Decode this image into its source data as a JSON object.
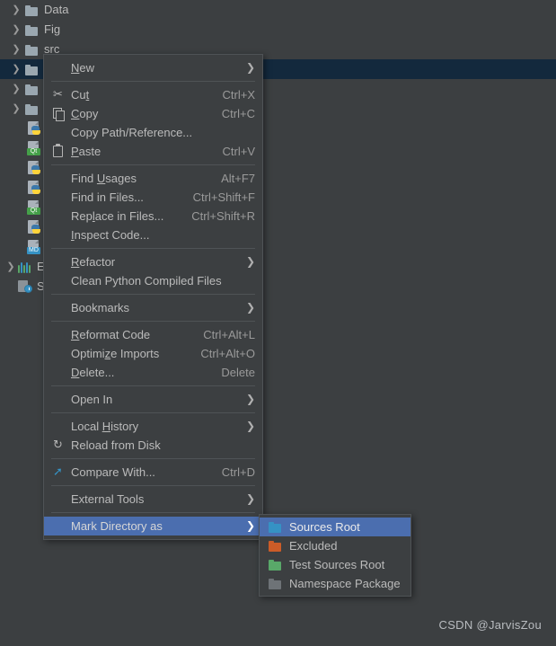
{
  "tree": {
    "folders": [
      {
        "label": "Data",
        "selected": false,
        "expandable": true
      },
      {
        "label": "Fig",
        "selected": false,
        "expandable": true
      },
      {
        "label": "src",
        "selected": false,
        "expandable": true
      },
      {
        "label": "",
        "selected": true,
        "expandable": true
      },
      {
        "label": "",
        "selected": false,
        "expandable": true
      },
      {
        "label": "",
        "selected": false,
        "expandable": true
      }
    ],
    "files": [
      {
        "label": "",
        "kind": "python",
        "badge": ""
      },
      {
        "label": "",
        "kind": "badge",
        "badge": "Qt"
      },
      {
        "label": "",
        "kind": "python",
        "badge": ""
      },
      {
        "label": "",
        "kind": "python",
        "badge": ""
      },
      {
        "label": "",
        "kind": "badge",
        "badge": "Qt"
      },
      {
        "label": "",
        "kind": "python",
        "badge": ""
      },
      {
        "label": "",
        "kind": "badge",
        "badge": "MD"
      }
    ],
    "external_libraries": "Ext",
    "scratches": "Scr"
  },
  "context_menu": {
    "items": [
      {
        "label": "New",
        "mnemonic": "N",
        "shortcut": "",
        "submenu": true,
        "icon": "",
        "sep_after": true
      },
      {
        "label": "Cut",
        "mnemonic": "t",
        "shortcut": "Ctrl+X",
        "submenu": false,
        "icon": "scissors-icon",
        "sep_after": false
      },
      {
        "label": "Copy",
        "mnemonic": "C",
        "shortcut": "Ctrl+C",
        "submenu": false,
        "icon": "copy-icon",
        "sep_after": false
      },
      {
        "label": "Copy Path/Reference...",
        "mnemonic": "",
        "shortcut": "",
        "submenu": false,
        "icon": "",
        "sep_after": false
      },
      {
        "label": "Paste",
        "mnemonic": "P",
        "shortcut": "Ctrl+V",
        "submenu": false,
        "icon": "paste-icon",
        "sep_after": true
      },
      {
        "label": "Find Usages",
        "mnemonic": "U",
        "shortcut": "Alt+F7",
        "submenu": false,
        "icon": "",
        "sep_after": false
      },
      {
        "label": "Find in Files...",
        "mnemonic": "",
        "shortcut": "Ctrl+Shift+F",
        "submenu": false,
        "icon": "",
        "sep_after": false
      },
      {
        "label": "Replace in Files...",
        "mnemonic": "l",
        "shortcut": "Ctrl+Shift+R",
        "submenu": false,
        "icon": "",
        "sep_after": false
      },
      {
        "label": "Inspect Code...",
        "mnemonic": "I",
        "shortcut": "",
        "submenu": false,
        "icon": "",
        "sep_after": true
      },
      {
        "label": "Refactor",
        "mnemonic": "R",
        "shortcut": "",
        "submenu": true,
        "icon": "",
        "sep_after": false
      },
      {
        "label": "Clean Python Compiled Files",
        "mnemonic": "",
        "shortcut": "",
        "submenu": false,
        "icon": "",
        "sep_after": true
      },
      {
        "label": "Bookmarks",
        "mnemonic": "",
        "shortcut": "",
        "submenu": true,
        "icon": "",
        "sep_after": true
      },
      {
        "label": "Reformat Code",
        "mnemonic": "R",
        "shortcut": "Ctrl+Alt+L",
        "submenu": false,
        "icon": "",
        "sep_after": false
      },
      {
        "label": "Optimize Imports",
        "mnemonic": "z",
        "shortcut": "Ctrl+Alt+O",
        "submenu": false,
        "icon": "",
        "sep_after": false
      },
      {
        "label": "Delete...",
        "mnemonic": "D",
        "shortcut": "Delete",
        "submenu": false,
        "icon": "",
        "sep_after": true
      },
      {
        "label": "Open In",
        "mnemonic": "",
        "shortcut": "",
        "submenu": true,
        "icon": "",
        "sep_after": true
      },
      {
        "label": "Local History",
        "mnemonic": "H",
        "shortcut": "",
        "submenu": true,
        "icon": "",
        "sep_after": false
      },
      {
        "label": "Reload from Disk",
        "mnemonic": "",
        "shortcut": "",
        "submenu": false,
        "icon": "reload-icon",
        "sep_after": true
      },
      {
        "label": "Compare With...",
        "mnemonic": "",
        "shortcut": "Ctrl+D",
        "submenu": false,
        "icon": "compare-icon",
        "sep_after": true
      },
      {
        "label": "External Tools",
        "mnemonic": "",
        "shortcut": "",
        "submenu": true,
        "icon": "",
        "sep_after": true
      },
      {
        "label": "Mark Directory as",
        "mnemonic": "",
        "shortcut": "",
        "submenu": true,
        "icon": "",
        "sep_after": false,
        "highlighted": true
      }
    ]
  },
  "submenu": {
    "items": [
      {
        "label": "Sources Root",
        "color": "blue",
        "highlighted": true
      },
      {
        "label": "Excluded",
        "color": "orange",
        "highlighted": false
      },
      {
        "label": "Test Sources Root",
        "color": "green",
        "highlighted": false
      },
      {
        "label": "Namespace Package",
        "color": "gray",
        "highlighted": false
      }
    ]
  },
  "watermark": "CSDN @JarvisZou",
  "colors": {
    "background": "#3c3f41",
    "menu_background": "#3c3f41",
    "selection_tree": "#13293d",
    "highlight": "#4b6eaf",
    "text": "#bbbbbb",
    "shortcut_text": "#9a9a9a",
    "separator": "#4f5356",
    "sources_root": "#3592c4",
    "excluded": "#cc5c28",
    "test_sources_root": "#59a869",
    "namespace_package": "#6e7377"
  }
}
